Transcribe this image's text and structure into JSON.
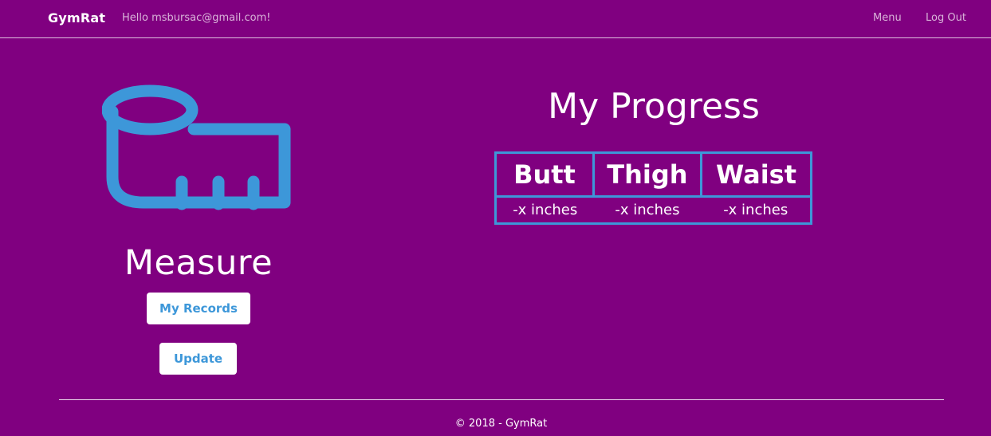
{
  "nav": {
    "brand": "GymRat",
    "greeting": "Hello msbursac@gmail.com!",
    "menu_label": "Menu",
    "logout_label": "Log Out"
  },
  "measure": {
    "icon": "measuring-tape-icon",
    "title": "Measure",
    "records_button": "My Records",
    "update_button": "Update"
  },
  "progress": {
    "title": "My Progress",
    "columns": [
      "Butt",
      "Thigh",
      "Waist"
    ],
    "values": [
      "-x inches",
      "-x inches",
      "-x inches"
    ]
  },
  "footer": {
    "text": "© 2018 - GymRat"
  },
  "colors": {
    "background": "#800080",
    "accent": "#3d97d9",
    "text": "#ffffff",
    "nav_link": "#d9b3d9"
  }
}
